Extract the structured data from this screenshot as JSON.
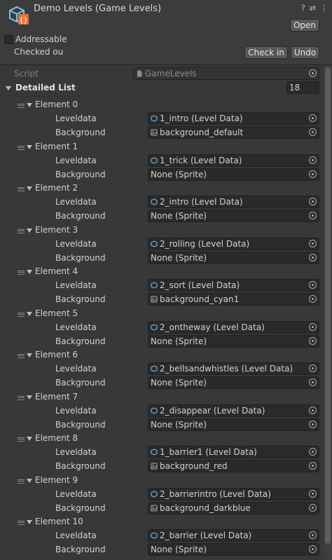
{
  "header": {
    "title": "Demo Levels (Game Levels)",
    "tools": [
      "?",
      "⇄",
      "⋮"
    ],
    "open_label": "Open",
    "addressable_label": "Addressable",
    "checked_out_label": "Checked ou",
    "check_in_label": "Check in",
    "undo_label": "Undo"
  },
  "script": {
    "label": "Script",
    "value": "GameLevels"
  },
  "list": {
    "label": "Detailed List",
    "size": "18",
    "leveldata_label": "Leveldata",
    "background_label": "Background",
    "elements": [
      {
        "name": "Element 0",
        "leveldata": "1_intro (Level Data)",
        "background": "background_default",
        "bg_has_sprite": true
      },
      {
        "name": "Element 1",
        "leveldata": "1_trick (Level Data)",
        "background": "None (Sprite)",
        "bg_has_sprite": false
      },
      {
        "name": "Element 2",
        "leveldata": "2_intro (Level Data)",
        "background": "None (Sprite)",
        "bg_has_sprite": false
      },
      {
        "name": "Element 3",
        "leveldata": "2_rolling (Level Data)",
        "background": "None (Sprite)",
        "bg_has_sprite": false
      },
      {
        "name": "Element 4",
        "leveldata": "2_sort (Level Data)",
        "background": "background_cyan1",
        "bg_has_sprite": true
      },
      {
        "name": "Element 5",
        "leveldata": "2_ontheway (Level Data)",
        "background": "None (Sprite)",
        "bg_has_sprite": false
      },
      {
        "name": "Element 6",
        "leveldata": "2_bellsandwhistles (Level Data)",
        "background": "None (Sprite)",
        "bg_has_sprite": false
      },
      {
        "name": "Element 7",
        "leveldata": "2_disappear (Level Data)",
        "background": "None (Sprite)",
        "bg_has_sprite": false
      },
      {
        "name": "Element 8",
        "leveldata": "1_barrier1 (Level Data)",
        "background": "background_red",
        "bg_has_sprite": true
      },
      {
        "name": "Element 9",
        "leveldata": "2_barrierintro (Level Data)",
        "background": "background_darkblue",
        "bg_has_sprite": true
      },
      {
        "name": "Element 10",
        "leveldata": "2_barrier (Level Data)",
        "background": "None (Sprite)",
        "bg_has_sprite": false
      }
    ]
  },
  "colors": {
    "panel": "#383838",
    "field": "#2a2a2a",
    "asset_icon_blue": "#6ab0e8",
    "script_icon_orange": "#e8743a"
  }
}
